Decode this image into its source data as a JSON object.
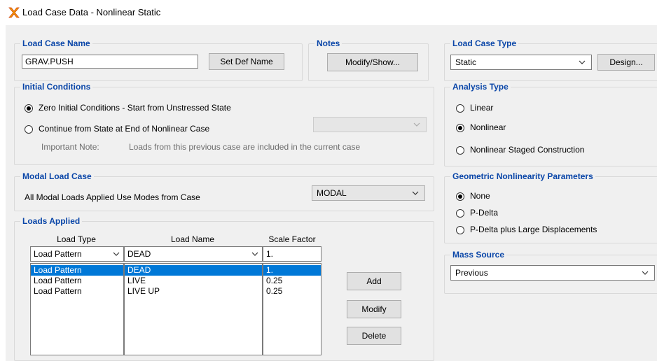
{
  "window": {
    "title": "Load Case Data - Nonlinear Static",
    "icon": "app-x-icon"
  },
  "load_case_name": {
    "legend": "Load Case Name",
    "value": "GRAV.PUSH",
    "set_def_name_label": "Set Def Name"
  },
  "notes": {
    "legend": "Notes",
    "modify_show_label": "Modify/Show..."
  },
  "load_case_type": {
    "legend": "Load Case Type",
    "value": "Static",
    "design_label": "Design..."
  },
  "initial_conditions": {
    "legend": "Initial Conditions",
    "option_zero": "Zero Initial Conditions - Start from Unstressed State",
    "option_continue": "Continue from State at End of Nonlinear Case",
    "selected": "zero",
    "important_note_label": "Important Note:",
    "important_note_text": "Loads from this previous case are included in the current case"
  },
  "analysis_type": {
    "legend": "Analysis Type",
    "options": [
      "Linear",
      "Nonlinear",
      "Nonlinear Staged Construction"
    ],
    "selected": "Nonlinear"
  },
  "modal_load_case": {
    "legend": "Modal Load Case",
    "label": "All Modal Loads Applied Use Modes from Case",
    "value": "MODAL"
  },
  "geometric_nonlinearity": {
    "legend": "Geometric Nonlinearity Parameters",
    "options": [
      "None",
      "P-Delta",
      "P-Delta plus Large Displacements"
    ],
    "selected": "None"
  },
  "loads_applied": {
    "legend": "Loads Applied",
    "headers": {
      "load_type": "Load Type",
      "load_name": "Load Name",
      "scale_factor": "Scale Factor"
    },
    "edit_row": {
      "load_type": "Load Pattern",
      "load_name": "DEAD",
      "scale_factor": "1."
    },
    "rows": [
      {
        "load_type": "Load Pattern",
        "load_name": "DEAD",
        "scale_factor": "1."
      },
      {
        "load_type": "Load Pattern",
        "load_name": "LIVE",
        "scale_factor": "0.25"
      },
      {
        "load_type": "Load Pattern",
        "load_name": "LIVE UP",
        "scale_factor": "0.25"
      }
    ],
    "selected_row": 0,
    "add_label": "Add",
    "modify_label": "Modify",
    "delete_label": "Delete"
  },
  "mass_source": {
    "legend": "Mass Source",
    "value": "Previous"
  },
  "colors": {
    "legend": "#0a46a8",
    "selection": "#0078d7",
    "dialog_bg": "#f0f0f0"
  }
}
